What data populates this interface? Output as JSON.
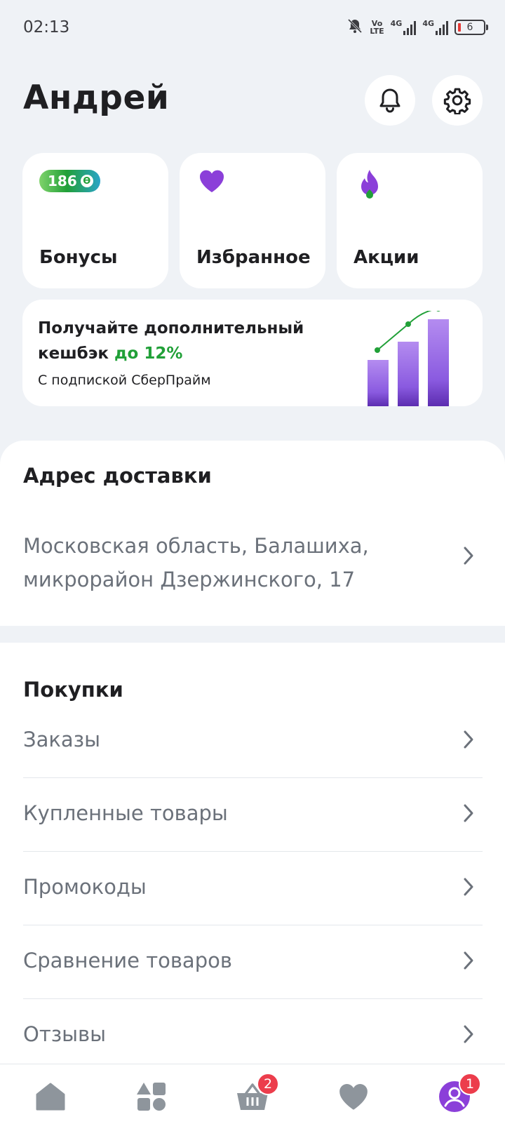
{
  "status_bar": {
    "time": "02:13",
    "volte_top": "Vo",
    "volte_bottom": "LTE",
    "network_1": "4G",
    "network_2": "4G",
    "battery": "6",
    "icons": [
      "mute-bell-icon",
      "volte-icon",
      "signal-icon",
      "signal-icon",
      "battery-icon"
    ]
  },
  "header": {
    "title": "Андрей",
    "icons": [
      "bell-icon",
      "gear-icon"
    ]
  },
  "tiles": [
    {
      "label": "Бонусы",
      "badge_value": "186",
      "icon": "bonus-coin-icon"
    },
    {
      "label": "Избранное",
      "icon": "heart-icon"
    },
    {
      "label": "Акции",
      "icon": "flame-icon"
    }
  ],
  "prime_banner": {
    "line1": "Получайте дополнительный",
    "line2_prefix": "кешбэк",
    "line2_accent": "до 12%",
    "subtitle": "С подпиской СберПрайм",
    "accent_color": "#21a038"
  },
  "address": {
    "title": "Адрес доставки",
    "text": "Московская область, Балашиха, микрорайон Дзержинского, 17"
  },
  "purchases": {
    "title": "Покупки",
    "items": [
      {
        "label": "Заказы"
      },
      {
        "label": "Купленные товары"
      },
      {
        "label": "Промокоды"
      },
      {
        "label": "Сравнение товаров"
      },
      {
        "label": "Отзывы"
      }
    ]
  },
  "bottom_nav": {
    "items": [
      {
        "name": "home",
        "icon": "home-icon"
      },
      {
        "name": "catalog",
        "icon": "catalog-icon"
      },
      {
        "name": "cart",
        "icon": "basket-icon",
        "badge": "2"
      },
      {
        "name": "favorites",
        "icon": "heart-icon"
      },
      {
        "name": "profile",
        "icon": "profile-icon",
        "badge": "1"
      }
    ],
    "active": "profile"
  },
  "colors": {
    "brand_green": "#21a038",
    "purple": "#8b3fd9",
    "badge_red": "#ec3d4c",
    "text_muted": "#6b717a"
  }
}
